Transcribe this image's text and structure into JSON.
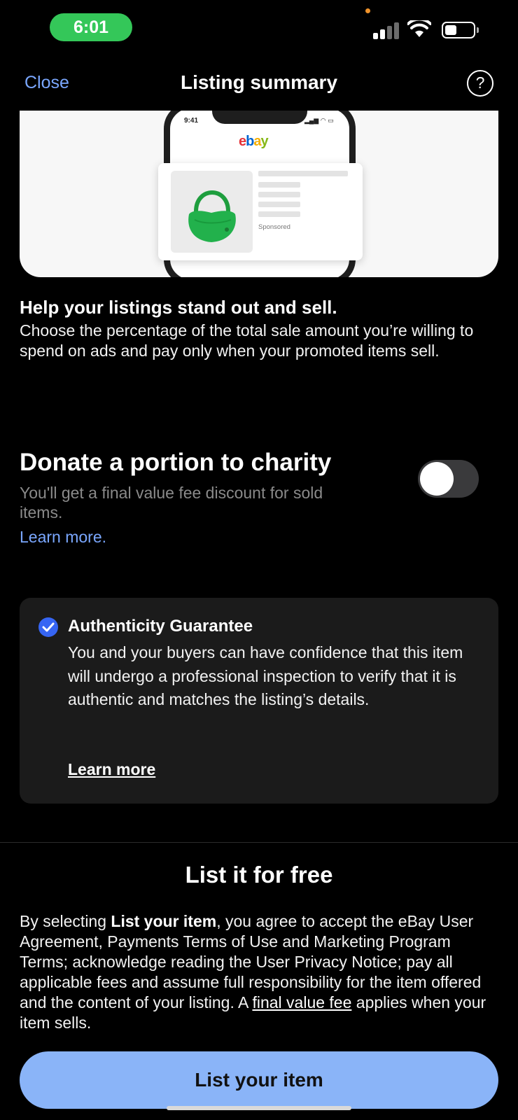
{
  "status_bar": {
    "time": "6:01"
  },
  "nav": {
    "close_label": "Close",
    "title": "Listing summary",
    "help_label": "?"
  },
  "banner": {
    "phone_time": "9:41",
    "logo": {
      "e": "e",
      "b": "b",
      "a": "a",
      "y": "y"
    },
    "sponsored": "Sponsored"
  },
  "promo": {
    "heading": "Help your listings stand out and sell.",
    "body": "Choose the percentage of the total sale amount you’re willing to spend on ads and pay only when your promoted items sell."
  },
  "charity": {
    "title": "Donate a portion to charity",
    "description": "You'll get a final value fee discount for sold items.",
    "learn_more": "Learn more.",
    "toggle_on": false
  },
  "authenticity": {
    "title": "Authenticity Guarantee",
    "body": "You and your buyers can have confidence that this item will undergo a professional inspection to verify that it is authentic and matches the listing’s details.",
    "learn_more": "Learn more",
    "checked": true
  },
  "free": {
    "title": "List it for free",
    "legal_pre": "By selecting ",
    "legal_bold": "List your item",
    "legal_mid": ", you agree to accept the eBay User Agreement, Payments Terms of Use and Marketing Program Terms; acknowledge reading the User Privacy Notice; pay all applicable fees and assume full responsibility for the item offered and the content of your listing. A ",
    "legal_link": "final value fee",
    "legal_post": " applies when your item sells."
  },
  "cta": {
    "label": "List your item"
  },
  "colors": {
    "accent_link": "#7aa7ff",
    "cta_bg": "#8ab4f8",
    "check_blue": "#3665f3",
    "time_pill": "#34c759"
  }
}
